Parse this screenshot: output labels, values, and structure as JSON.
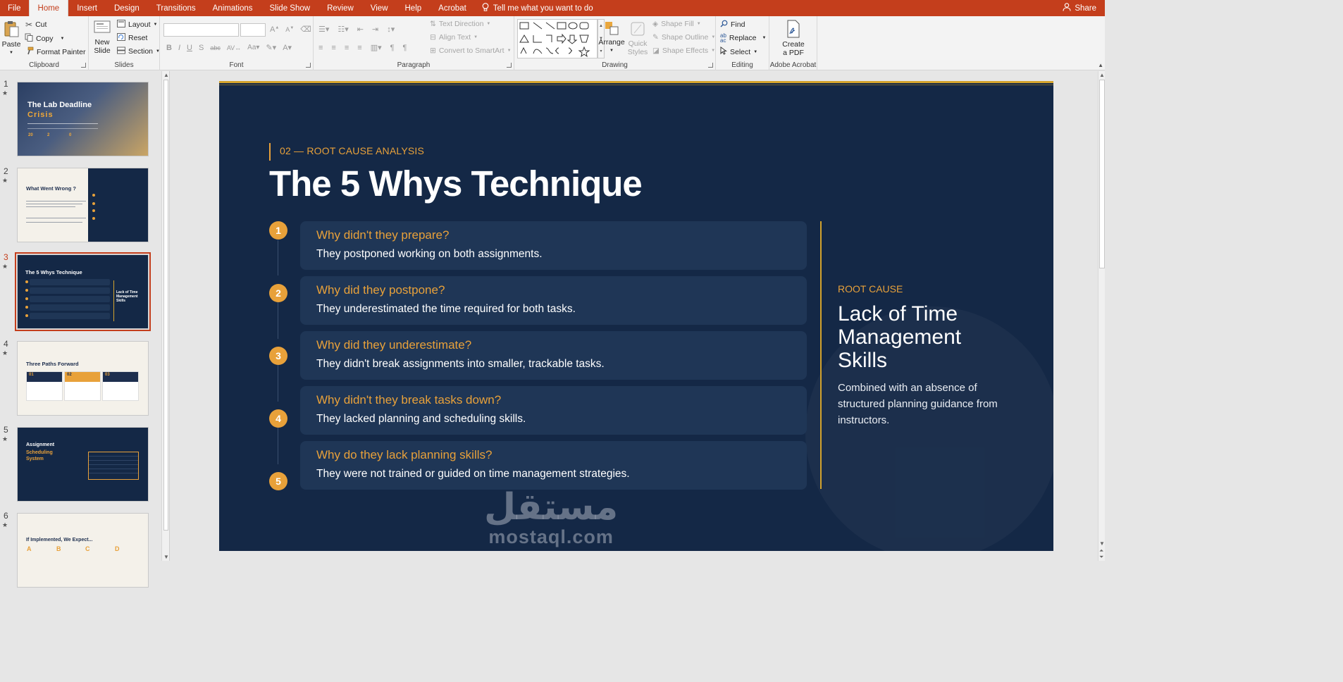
{
  "menu": {
    "file": "File",
    "tabs": [
      "Home",
      "Insert",
      "Design",
      "Transitions",
      "Animations",
      "Slide Show",
      "Review",
      "View",
      "Help",
      "Acrobat"
    ],
    "tell_me": "Tell me what you want to do",
    "share": "Share"
  },
  "ribbon": {
    "clipboard": {
      "label": "Clipboard",
      "paste": "Paste",
      "cut": "Cut",
      "copy": "Copy",
      "format_painter": "Format Painter"
    },
    "slides": {
      "label": "Slides",
      "new_slide_1": "New",
      "new_slide_2": "Slide",
      "layout": "Layout",
      "reset": "Reset",
      "section": "Section"
    },
    "font": {
      "label": "Font",
      "font_name": "",
      "font_size": ""
    },
    "paragraph": {
      "label": "Paragraph",
      "text_direction": "Text Direction",
      "align_text": "Align Text",
      "convert_smartart": "Convert to SmartArt"
    },
    "drawing": {
      "label": "Drawing",
      "arrange": "Arrange",
      "quick_styles_1": "Quick",
      "quick_styles_2": "Styles",
      "shape_fill": "Shape Fill",
      "shape_outline": "Shape Outline",
      "shape_effects": "Shape Effects"
    },
    "editing": {
      "label": "Editing",
      "find": "Find",
      "replace": "Replace",
      "select": "Select"
    },
    "acrobat": {
      "label": "Adobe Acrobat",
      "create_1": "Create",
      "create_2": "a PDF"
    }
  },
  "thumbnails": {
    "numbers": [
      "1",
      "2",
      "3",
      "4",
      "5",
      "6"
    ],
    "t1": {
      "title": "The Lab Deadline",
      "subtitle": "Crisis",
      "stats": [
        "20",
        "2",
        "0"
      ]
    },
    "t2": {
      "title": "What Went Wrong ?"
    },
    "t3": {
      "title": "The 5 Whys Technique",
      "right": "Lack of Time Management Skills"
    },
    "t4": {
      "title": "Three Paths Forward",
      "cards": [
        "01",
        "02",
        "03"
      ]
    },
    "t5": {
      "title": "Assignment",
      "title2": "Scheduling System"
    },
    "t6": {
      "title": "If Implemented, We Expect...",
      "letters": [
        "A",
        "B",
        "C",
        "D"
      ]
    }
  },
  "slide": {
    "kicker": "02 — ROOT CAUSE ANALYSIS",
    "title": "The 5 Whys Technique",
    "whys": [
      {
        "num": "1",
        "question": "Why didn't they prepare?",
        "answer": "They postponed working on both assignments."
      },
      {
        "num": "2",
        "question": "Why did they postpone?",
        "answer": "They underestimated the time required for both tasks."
      },
      {
        "num": "3",
        "question": "Why did they underestimate?",
        "answer": "They didn't break assignments into smaller, trackable tasks."
      },
      {
        "num": "4",
        "question": "Why didn't they break tasks down?",
        "answer": "They lacked planning and scheduling skills."
      },
      {
        "num": "5",
        "question": "Why do they lack planning skills?",
        "answer": "They were not trained or guided on time management strategies."
      }
    ],
    "root_cause_label": "ROOT CAUSE",
    "root_cause_title": "Lack of Time Management Skills",
    "root_cause_body": "Combined with an absence of structured planning guidance from instructors.",
    "watermark_ar": "مستقل",
    "watermark_lat": "mostaql.com"
  },
  "colors": {
    "accent": "#c43e1c",
    "navy": "#142846",
    "gold": "#e8a13a"
  }
}
